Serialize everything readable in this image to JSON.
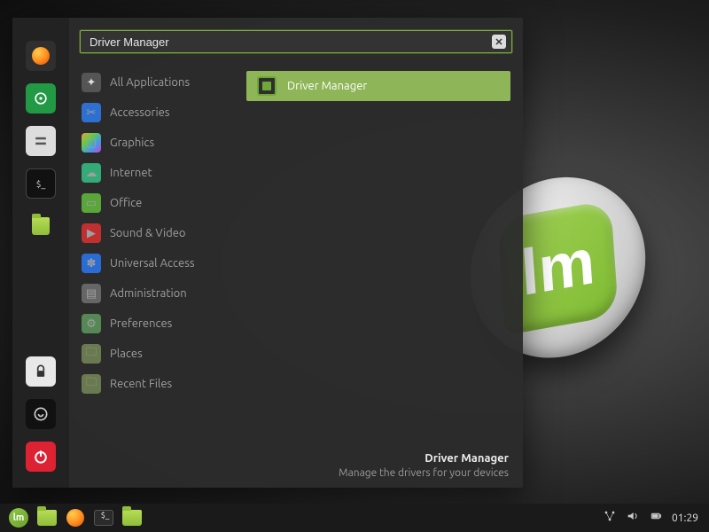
{
  "search": {
    "value": "Driver Manager"
  },
  "favorites": [
    {
      "name": "firefox"
    },
    {
      "name": "software-manager"
    },
    {
      "name": "settings"
    },
    {
      "name": "terminal"
    },
    {
      "name": "files"
    },
    {
      "name": "lock"
    },
    {
      "name": "logout"
    },
    {
      "name": "shutdown"
    }
  ],
  "categories": [
    {
      "id": "all",
      "label": "All Applications",
      "cls": "c-all"
    },
    {
      "id": "acc",
      "label": "Accessories",
      "cls": "c-acc"
    },
    {
      "id": "gfx",
      "label": "Graphics",
      "cls": "c-gfx"
    },
    {
      "id": "net",
      "label": "Internet",
      "cls": "c-net"
    },
    {
      "id": "off",
      "label": "Office",
      "cls": "c-off"
    },
    {
      "id": "snd",
      "label": "Sound & Video",
      "cls": "c-snd"
    },
    {
      "id": "ua",
      "label": "Universal Access",
      "cls": "c-ua"
    },
    {
      "id": "adm",
      "label": "Administration",
      "cls": "c-adm"
    },
    {
      "id": "pref",
      "label": "Preferences",
      "cls": "c-pref"
    },
    {
      "id": "places",
      "label": "Places",
      "cls": "c-places"
    },
    {
      "id": "recent",
      "label": "Recent Files",
      "cls": "c-recent"
    }
  ],
  "results": [
    {
      "label": "Driver Manager",
      "selected": true
    }
  ],
  "description": {
    "title": "Driver Manager",
    "subtitle": "Manage the drivers for your devices"
  },
  "panel": {
    "launchers": [
      {
        "name": "menu",
        "icon": "mint"
      },
      {
        "name": "files",
        "icon": "files"
      },
      {
        "name": "firefox",
        "icon": "firefox"
      },
      {
        "name": "terminal",
        "icon": "term"
      },
      {
        "name": "files2",
        "icon": "files"
      }
    ],
    "clock": "01:29"
  }
}
